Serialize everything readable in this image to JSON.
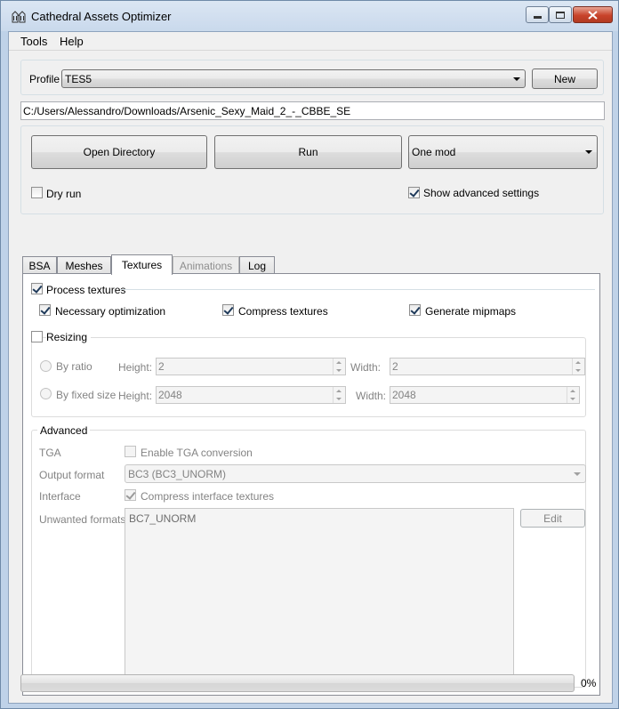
{
  "window": {
    "title": "Cathedral Assets Optimizer"
  },
  "menu": [
    "Tools",
    "Help"
  ],
  "profile": {
    "label": "Profile",
    "value": "TES5",
    "new_button": "New"
  },
  "path": "C:/Users/Alessandro/Downloads/Arsenic_Sexy_Maid_2_-_CBBE_SE",
  "actions": {
    "open_directory": "Open Directory",
    "run": "Run",
    "mode": "One mod",
    "dry_run": "Dry run",
    "show_advanced": "Show advanced settings"
  },
  "tabs": [
    "BSA",
    "Meshes",
    "Textures",
    "Animations",
    "Log"
  ],
  "textures": {
    "process": "Process textures",
    "necessary": "Necessary optimization",
    "compress": "Compress textures",
    "mipmaps": "Generate mipmaps",
    "resizing": {
      "title": "Resizing",
      "by_ratio": "By ratio",
      "by_fixed": "By fixed size",
      "height_label": "Height:",
      "width_label": "Width:",
      "ratio_height": "2",
      "ratio_width": "2",
      "fixed_height": "2048",
      "fixed_width": "2048"
    },
    "advanced": {
      "title": "Advanced",
      "tga_label": "TGA",
      "tga_check": "Enable TGA conversion",
      "output_label": "Output format",
      "output_value": "BC3 (BC3_UNORM)",
      "interface_label": "Interface",
      "interface_check": "Compress interface textures",
      "unwanted_label": "Unwanted formats",
      "unwanted_value": "BC7_UNORM",
      "edit": "Edit"
    }
  },
  "progress": {
    "value": 0,
    "label": "0%"
  },
  "colors": {
    "accent": "#3c7fb1",
    "close": "#c8432a"
  }
}
